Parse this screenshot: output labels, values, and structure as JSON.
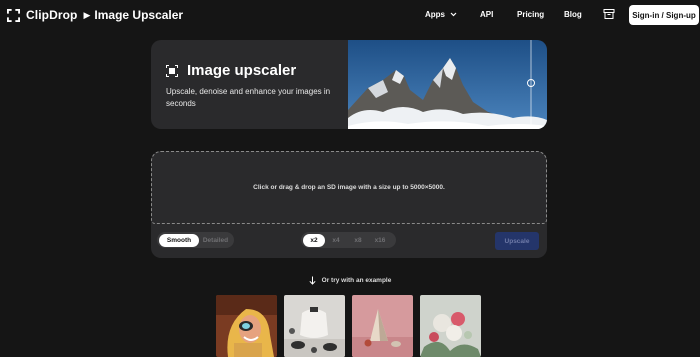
{
  "header": {
    "brand": "ClipDrop",
    "breadcrumb_arrow": "▶",
    "page_name": "Image Upscaler",
    "nav": {
      "apps": "Apps",
      "api": "API",
      "pricing": "Pricing",
      "blog": "Blog"
    },
    "signin": "Sign-in / Sign-up"
  },
  "hero": {
    "title": "Image upscaler",
    "subtitle": "Upscale, denoise and enhance your images in seconds"
  },
  "upload": {
    "drop_text": "Click or drag & drop an SD image with a size up to 5000×5000.",
    "modes": [
      {
        "label": "Smooth",
        "active": true
      },
      {
        "label": "Detailed",
        "active": false
      }
    ],
    "scales": [
      {
        "label": "x2",
        "active": true
      },
      {
        "label": "x4",
        "active": false
      },
      {
        "label": "x8",
        "active": false
      },
      {
        "label": "x16",
        "active": false
      }
    ],
    "upscale_label": "Upscale"
  },
  "examples": {
    "prompt": "Or try with an example",
    "thumbnails": [
      "woman-laughing",
      "kettle-and-cups",
      "pink-cone-still-life",
      "flower-bouquet"
    ]
  },
  "colors": {
    "background": "#151515",
    "card": "#2a2a2c",
    "upscale_button": "#24356a"
  }
}
